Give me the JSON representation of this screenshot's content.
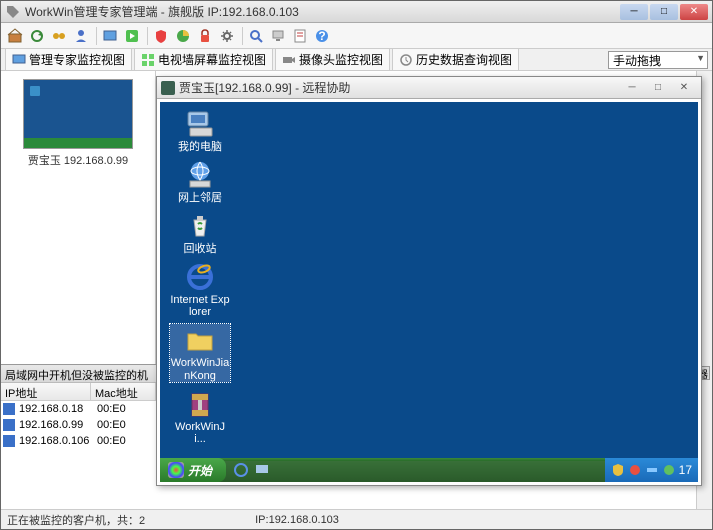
{
  "window": {
    "title": "WorkWin管理专家管理端 - 旗舰版 IP:192.168.0.103"
  },
  "tabs": {
    "t1": "管理专家监控视图",
    "t2": "电视墙屏幕监控视图",
    "t3": "摄像头监控视图",
    "t4": "历史数据查询视图"
  },
  "dropdown": {
    "selected": "手动拖拽"
  },
  "thumbnail": {
    "label": "贾宝玉 192.168.0.99"
  },
  "bottom_panel": {
    "header": "局域网中开机但没被监控的机",
    "col_ip": "IP地址",
    "col_mac": "Mac地址",
    "rows": [
      {
        "ip": "192.168.0.18",
        "mac": "00:E0"
      },
      {
        "ip": "192.168.0.99",
        "mac": "00:E0"
      },
      {
        "ip": "192.168.0.106",
        "mac": "00:E0"
      }
    ]
  },
  "remote": {
    "title": "贾宝玉[192.168.0.99] - 远程协助",
    "icons": {
      "mycomputer": "我的电脑",
      "network": "网上邻居",
      "recycle": "回收站",
      "ie": "Internet Explorer",
      "folder": "WorkWinJianKong",
      "rar": "WorkWinJi..."
    },
    "start": "开始",
    "clock": "17"
  },
  "status": {
    "left": "正在被监控的客户机，共：2",
    "ip": "IP:192.168.0.103"
  }
}
